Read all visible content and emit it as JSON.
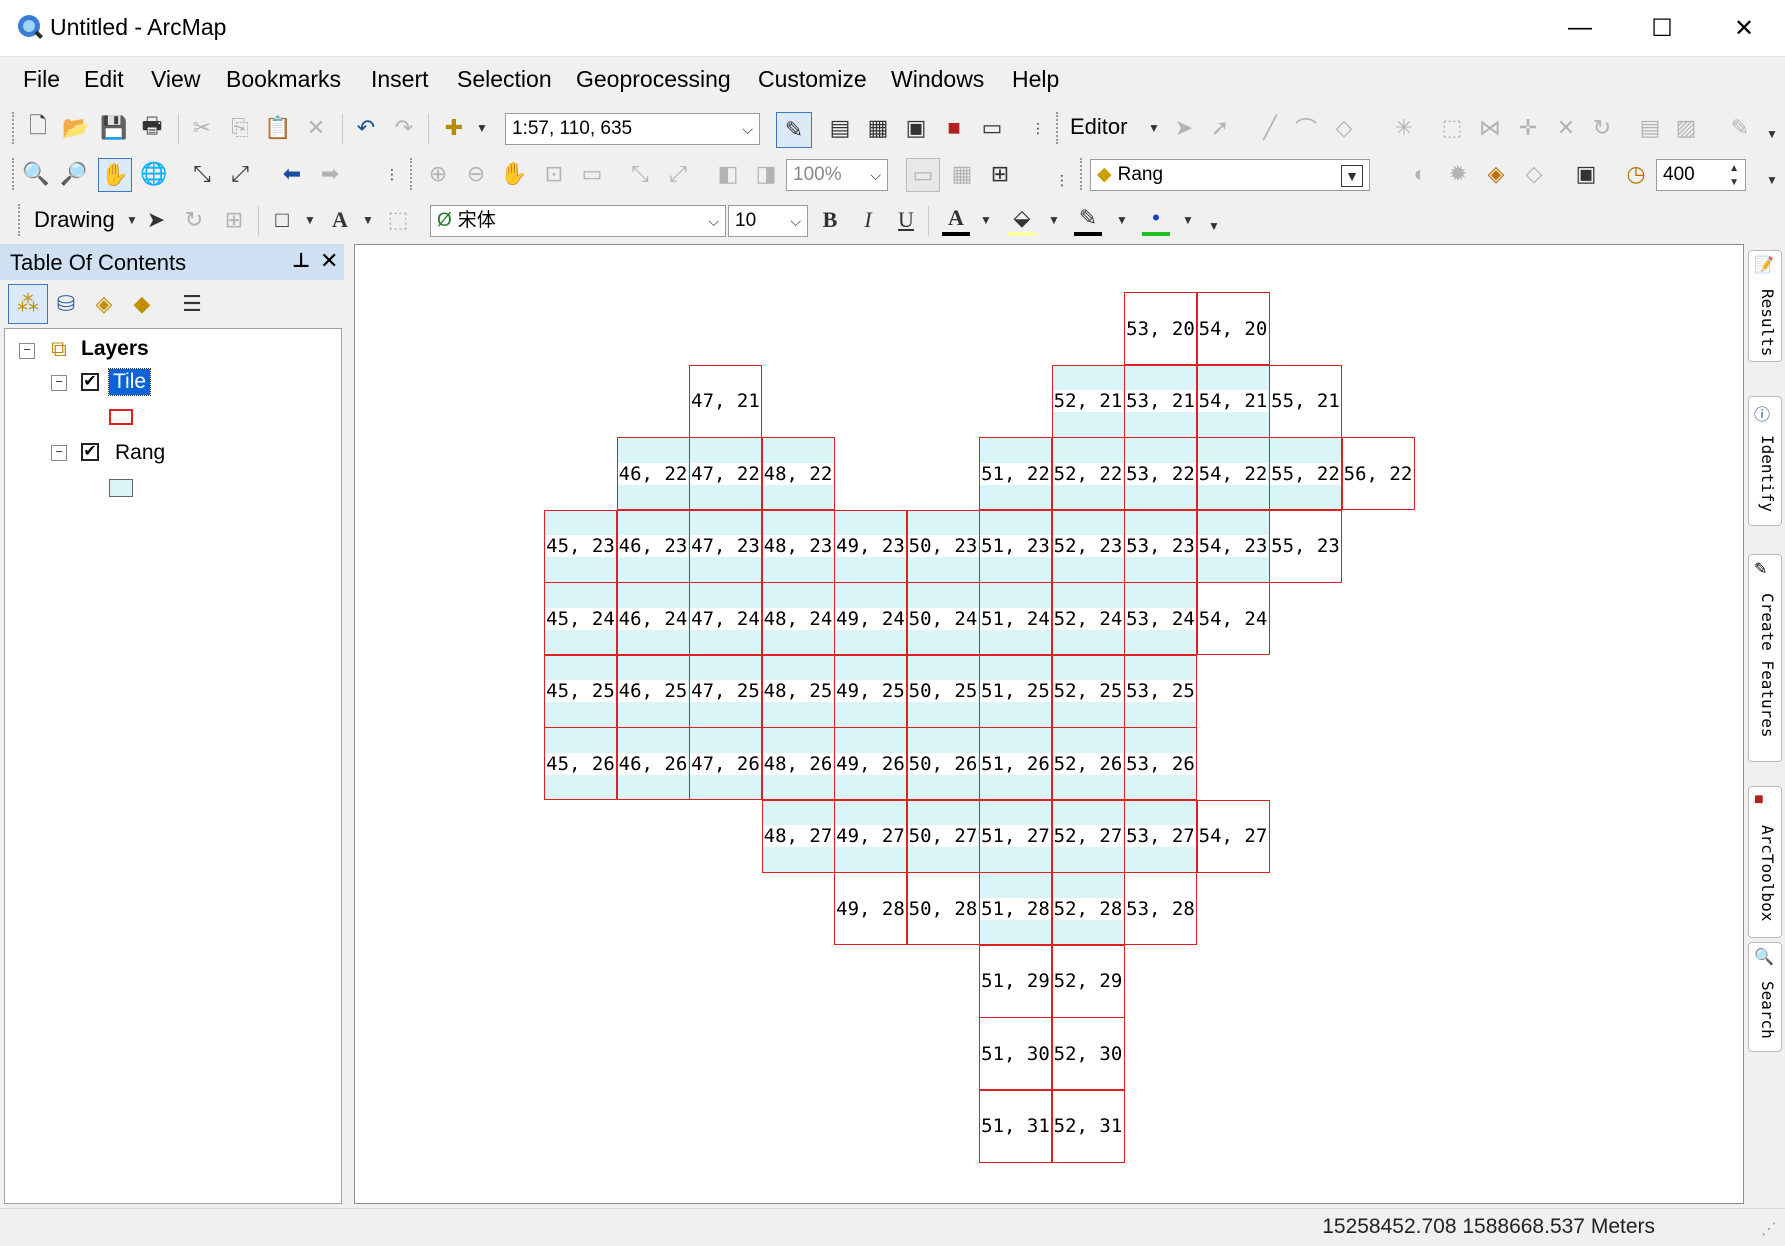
{
  "window": {
    "title": "Untitled - ArcMap",
    "minimize": "—",
    "maximize": "☐",
    "close": "✕"
  },
  "menu": [
    "File",
    "Edit",
    "View",
    "Bookmarks",
    "Insert",
    "Selection",
    "Geoprocessing",
    "Customize",
    "Windows",
    "Help"
  ],
  "standard_toolbar": {
    "scale": "1:57, 110, 635",
    "editor_label": "Editor"
  },
  "tools_toolbar": {
    "zoom_percent": "100%",
    "layer_combo": "Rang",
    "resolution": "400"
  },
  "drawing_toolbar": {
    "drawing_label": "Drawing",
    "font": "宋体",
    "font_size": "10",
    "bold": "B",
    "italic": "I",
    "underline": "U",
    "text_A": "A"
  },
  "toc": {
    "title": "Table Of Contents",
    "pin": "ᵖ",
    "close": "✕",
    "root": "Layers",
    "layers": [
      {
        "name": "Tile",
        "checked": "✔",
        "symbol": "red-outline"
      },
      {
        "name": "Rang",
        "checked": "✔",
        "symbol": "cyan-fill"
      }
    ]
  },
  "map": {
    "tiles": [
      "53, 20",
      "54, 20",
      "47, 21",
      "52, 21",
      "53, 21",
      "54, 21",
      "55, 21",
      "46, 22",
      "47, 22",
      "48, 22",
      "51, 22",
      "52, 22",
      "53, 22",
      "54, 22",
      "55, 22",
      "56, 22",
      "45, 23",
      "46, 23",
      "47, 23",
      "48, 23",
      "49, 23",
      "50, 23",
      "51, 23",
      "52, 23",
      "53, 23",
      "54, 23",
      "55, 23",
      "45, 24",
      "46, 24",
      "47, 24",
      "48, 24",
      "49, 24",
      "50, 24",
      "51, 24",
      "52, 24",
      "53, 24",
      "54, 24",
      "45, 25",
      "46, 25",
      "47, 25",
      "48, 25",
      "49, 25",
      "50, 25",
      "51, 25",
      "52, 25",
      "53, 25",
      "45, 26",
      "46, 26",
      "47, 26",
      "48, 26",
      "49, 26",
      "50, 26",
      "51, 26",
      "52, 26",
      "53, 26",
      "48, 27",
      "49, 27",
      "50, 27",
      "51, 27",
      "52, 27",
      "53, 27",
      "54, 27",
      "49, 28",
      "50, 28",
      "51, 28",
      "52, 28",
      "53, 28",
      "51, 29",
      "52, 29",
      "51, 30",
      "52, 30",
      "51, 31",
      "52, 31"
    ],
    "fill_color": "#d9f5f7",
    "outline_color": "#e02020"
  },
  "right_dock": [
    "Results",
    "Identify",
    "Create Features",
    "ArcToolbox",
    "Search"
  ],
  "status": {
    "coords": "15258452.708  1588668.537 Meters"
  }
}
